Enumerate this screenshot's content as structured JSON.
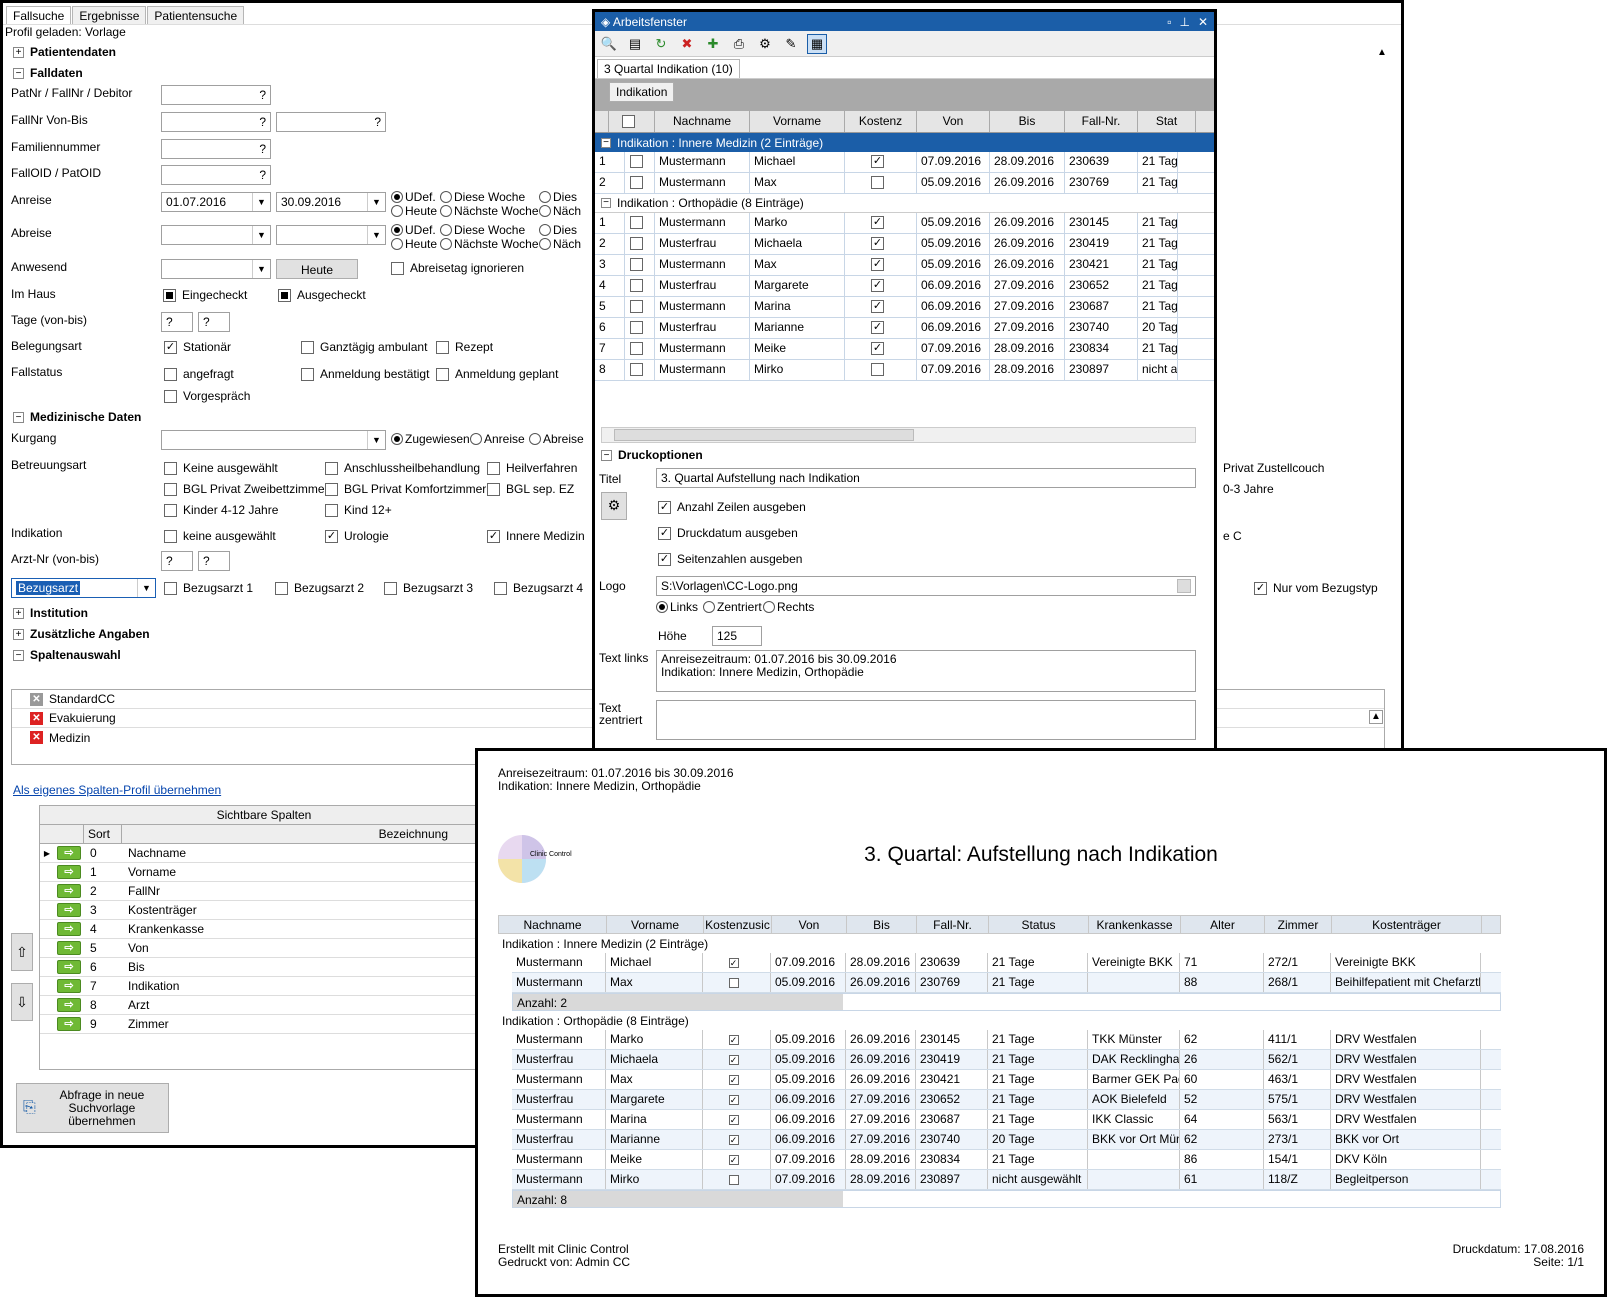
{
  "main": {
    "tabs": [
      "Fallsuche",
      "Ergebnisse",
      "Patientensuche"
    ],
    "profile": "Profil geladen: Vorlage",
    "sections": {
      "patientendaten": "Patientendaten",
      "falldaten": "Falldaten",
      "medizinische": "Medizinische Daten",
      "institution": "Institution",
      "zusaetzlich": "Zusätzliche Angaben",
      "spaltenauswahl": "Spaltenauswahl"
    },
    "labels": {
      "patnr": "PatNr / FallNr / Debitor",
      "fallnr": "FallNr Von-Bis",
      "familie": "Familiennummer",
      "falloid": "FallOID / PatOID",
      "anreise": "Anreise",
      "abreise": "Abreise",
      "anwesend": "Anwesend",
      "imhaus": "Im Haus",
      "tage": "Tage (von-bis)",
      "belegungsart": "Belegungsart",
      "fallstatus": "Fallstatus",
      "kurgang": "Kurgang",
      "betreuungsart": "Betreuungsart",
      "indikation": "Indikation",
      "arztnr": "Arzt-Nr (von-bis)"
    },
    "q": "?",
    "anreise_from": "01.07.2016",
    "anreise_to": "30.09.2016",
    "radio": {
      "udef": "UDef.",
      "diese_woche": "Diese Woche",
      "diese": "Dies",
      "heute": "Heute",
      "naechste_woche": "Nächste Woche",
      "naechste": "Näch"
    },
    "heute_btn": "Heute",
    "abreisetag": "Abreisetag ignorieren",
    "imhaus": {
      "eingecheckt": "Eingecheckt",
      "ausgecheckt": "Ausgecheckt"
    },
    "belegung": {
      "stationaer": "Stationär",
      "ganztaegig": "Ganztägig ambulant",
      "rezept": "Rezept"
    },
    "fallstatus": {
      "angefragt": "angefragt",
      "bestaetigt": "Anmeldung bestätigt",
      "geplant": "Anmeldung geplant",
      "vorgespraech": "Vorgespräch"
    },
    "kurgang": {
      "zugewiesen": "Zugewiesen",
      "anreise": "Anreise",
      "abreise": "Abreise"
    },
    "betreuung": {
      "keine": "Keine ausgewählt",
      "anschluss": "Anschlussheilbehandlung",
      "heil": "Heilverfahren",
      "privat": "Privat Zustellcouch",
      "bgl_zwei": "BGL Privat Zweibettzimmer",
      "bgl_komf": "BGL Privat Komfortzimmer",
      "bgl_sep": "BGL sep. EZ",
      "jahre03": "0-3 Jahre",
      "kinder": "Kinder 4-12 Jahre",
      "kind12": "Kind 12+"
    },
    "indikation": {
      "keine": "keine ausgewählt",
      "urologie": "Urologie",
      "innere": "Innere Medizin",
      "c": "e C"
    },
    "bezugsarzt": {
      "select": "Bezugsarzt",
      "b1": "Bezugsarzt 1",
      "b2": "Bezugsarzt 2",
      "b3": "Bezugsarzt 3",
      "b4": "Bezugsarzt 4",
      "nur": "Nur vom Bezugstyp"
    },
    "profiles": [
      "StandardCC",
      "Evakuierung",
      "Medizin"
    ],
    "link": "Als eigenes Spalten-Profil übernehmen",
    "cols_title": "Sichtbare Spalten",
    "cols_sort": "Sort",
    "cols_bez": "Bezeichnung",
    "cols": [
      {
        "n": "0",
        "b": "Nachname"
      },
      {
        "n": "1",
        "b": "Vorname"
      },
      {
        "n": "2",
        "b": "FallNr"
      },
      {
        "n": "3",
        "b": "Kostenträger"
      },
      {
        "n": "4",
        "b": "Krankenkasse"
      },
      {
        "n": "5",
        "b": "Von"
      },
      {
        "n": "6",
        "b": "Bis"
      },
      {
        "n": "7",
        "b": "Indikation"
      },
      {
        "n": "8",
        "b": "Arzt"
      },
      {
        "n": "9",
        "b": "Zimmer"
      }
    ],
    "bottom_btn": "Abfrage in neue Suchvorlage übernehmen"
  },
  "work": {
    "title": "Arbeitsfenster",
    "tab": "3 Quartal Indikation (10)",
    "group_btn": "Indikation",
    "heads": [
      "Nachname",
      "Vorname",
      "Kostenz",
      "Von",
      "Bis",
      "Fall-Nr.",
      "Stat"
    ],
    "g1": "Indikation : Innere Medizin (2 Einträge)",
    "g2": "Indikation : Orthopädie (8 Einträge)",
    "rows1": [
      {
        "n": "1",
        "ln": "Mustermann",
        "fn": "Michael",
        "k": "✓",
        "von": "07.09.2016",
        "bis": "28.09.2016",
        "f": "230639",
        "s": "21 Tage"
      },
      {
        "n": "2",
        "ln": "Mustermann",
        "fn": "Max",
        "k": "",
        "von": "05.09.2016",
        "bis": "26.09.2016",
        "f": "230769",
        "s": "21 Tage"
      }
    ],
    "rows2": [
      {
        "n": "1",
        "ln": "Mustermann",
        "fn": "Marko",
        "k": "✓",
        "von": "05.09.2016",
        "bis": "26.09.2016",
        "f": "230145",
        "s": "21 Tage"
      },
      {
        "n": "2",
        "ln": "Musterfrau",
        "fn": "Michaela",
        "k": "✓",
        "von": "05.09.2016",
        "bis": "26.09.2016",
        "f": "230419",
        "s": "21 Tage"
      },
      {
        "n": "3",
        "ln": "Mustermann",
        "fn": "Max",
        "k": "✓",
        "von": "05.09.2016",
        "bis": "26.09.2016",
        "f": "230421",
        "s": "21 Tage"
      },
      {
        "n": "4",
        "ln": "Musterfrau",
        "fn": "Margarete",
        "k": "✓",
        "von": "06.09.2016",
        "bis": "27.09.2016",
        "f": "230652",
        "s": "21 Tage"
      },
      {
        "n": "5",
        "ln": "Mustermann",
        "fn": "Marina",
        "k": "✓",
        "von": "06.09.2016",
        "bis": "27.09.2016",
        "f": "230687",
        "s": "21 Tage"
      },
      {
        "n": "6",
        "ln": "Musterfrau",
        "fn": "Marianne",
        "k": "✓",
        "von": "06.09.2016",
        "bis": "27.09.2016",
        "f": "230740",
        "s": "20 Tage"
      },
      {
        "n": "7",
        "ln": "Mustermann",
        "fn": "Meike",
        "k": "✓",
        "von": "07.09.2016",
        "bis": "28.09.2016",
        "f": "230834",
        "s": "21 Tage"
      },
      {
        "n": "8",
        "ln": "Mustermann",
        "fn": "Mirko",
        "k": "",
        "von": "07.09.2016",
        "bis": "28.09.2016",
        "f": "230897",
        "s": "nicht au"
      }
    ],
    "druck": "Druckoptionen",
    "titel_lbl": "Titel",
    "titel_val": "3. Quartal Aufstellung nach Indikation",
    "opt1": "Anzahl Zeilen ausgeben",
    "opt2": "Druckdatum ausgeben",
    "opt3": "Seitenzahlen ausgeben",
    "logo_lbl": "Logo",
    "logo_val": "S:\\Vorlagen\\CC-Logo.png",
    "links": "Links",
    "zentriert": "Zentriert",
    "rechts": "Rechts",
    "hoehe_lbl": "Höhe",
    "hoehe_val": "125",
    "textlinks_lbl": "Text links",
    "textlinks_val1": "Anreisezeitraum: 01.07.2016 bis 30.09.2016",
    "textlinks_val2": "Indikation: Innere Medizin, Orthopädie",
    "textzent_lbl": "Text zentriert"
  },
  "print": {
    "hdr1": "Anreisezeitraum: 01.07.2016 bis 30.09.2016",
    "hdr2": "Indikation: Innere Medizin, Orthopädie",
    "logo_text": "Clinic Control",
    "title": "3. Quartal: Aufstellung nach Indikation",
    "heads": [
      "Nachname",
      "Vorname",
      "Kostenzusic",
      "Von",
      "Bis",
      "Fall-Nr.",
      "Status",
      "Krankenkasse",
      "Alter",
      "Zimmer",
      "Kostenträger"
    ],
    "g1": "Indikation : Innere Medizin (2 Einträge)",
    "g2": "Indikation : Orthopädie (8 Einträge)",
    "rows1": [
      {
        "ln": "Mustermann",
        "fn": "Michael",
        "k": "✓",
        "von": "07.09.2016",
        "bis": "28.09.2016",
        "f": "230639",
        "s": "21 Tage",
        "kk": "Vereinigte BKK",
        "a": "71",
        "z": "272/1",
        "kt": "Vereinigte BKK"
      },
      {
        "ln": "Mustermann",
        "fn": "Max",
        "k": "",
        "von": "05.09.2016",
        "bis": "26.09.2016",
        "f": "230769",
        "s": "21 Tage",
        "kk": "",
        "a": "88",
        "z": "268/1",
        "kt": "Beihilfepatient mit Chefarztb"
      }
    ],
    "anzahl1": "Anzahl: 2",
    "rows2": [
      {
        "ln": "Mustermann",
        "fn": "Marko",
        "k": "✓",
        "von": "05.09.2016",
        "bis": "26.09.2016",
        "f": "230145",
        "s": "21 Tage",
        "kk": "TKK Münster",
        "a": "62",
        "z": "411/1",
        "kt": "DRV Westfalen"
      },
      {
        "ln": "Musterfrau",
        "fn": "Michaela",
        "k": "✓",
        "von": "05.09.2016",
        "bis": "26.09.2016",
        "f": "230419",
        "s": "21 Tage",
        "kk": "DAK Recklingha",
        "a": "26",
        "z": "562/1",
        "kt": "DRV Westfalen"
      },
      {
        "ln": "Mustermann",
        "fn": "Max",
        "k": "✓",
        "von": "05.09.2016",
        "bis": "26.09.2016",
        "f": "230421",
        "s": "21 Tage",
        "kk": "Barmer GEK Pad",
        "a": "60",
        "z": "463/1",
        "kt": "DRV Westfalen"
      },
      {
        "ln": "Musterfrau",
        "fn": "Margarete",
        "k": "✓",
        "von": "06.09.2016",
        "bis": "27.09.2016",
        "f": "230652",
        "s": "21 Tage",
        "kk": "AOK Bielefeld",
        "a": "52",
        "z": "575/1",
        "kt": "DRV Westfalen"
      },
      {
        "ln": "Mustermann",
        "fn": "Marina",
        "k": "✓",
        "von": "06.09.2016",
        "bis": "27.09.2016",
        "f": "230687",
        "s": "21 Tage",
        "kk": "IKK Classic",
        "a": "64",
        "z": "563/1",
        "kt": "DRV Westfalen"
      },
      {
        "ln": "Musterfrau",
        "fn": "Marianne",
        "k": "✓",
        "von": "06.09.2016",
        "bis": "27.09.2016",
        "f": "230740",
        "s": "20 Tage",
        "kk": "BKK vor Ort Mün",
        "a": "62",
        "z": "273/1",
        "kt": "BKK vor Ort"
      },
      {
        "ln": "Mustermann",
        "fn": "Meike",
        "k": "✓",
        "von": "07.09.2016",
        "bis": "28.09.2016",
        "f": "230834",
        "s": "21 Tage",
        "kk": "",
        "a": "86",
        "z": "154/1",
        "kt": "DKV Köln"
      },
      {
        "ln": "Mustermann",
        "fn": "Mirko",
        "k": "",
        "von": "07.09.2016",
        "bis": "28.09.2016",
        "f": "230897",
        "s": "nicht ausgewählt",
        "kk": "",
        "a": "61",
        "z": "118/Z",
        "kt": "Begleitperson"
      }
    ],
    "anzahl2": "Anzahl: 8",
    "foot1": "Erstellt mit Clinic Control",
    "foot2": "Gedruckt von: Admin CC",
    "date": "Druckdatum: 17.08.2016",
    "page": "Seite: 1/1"
  }
}
